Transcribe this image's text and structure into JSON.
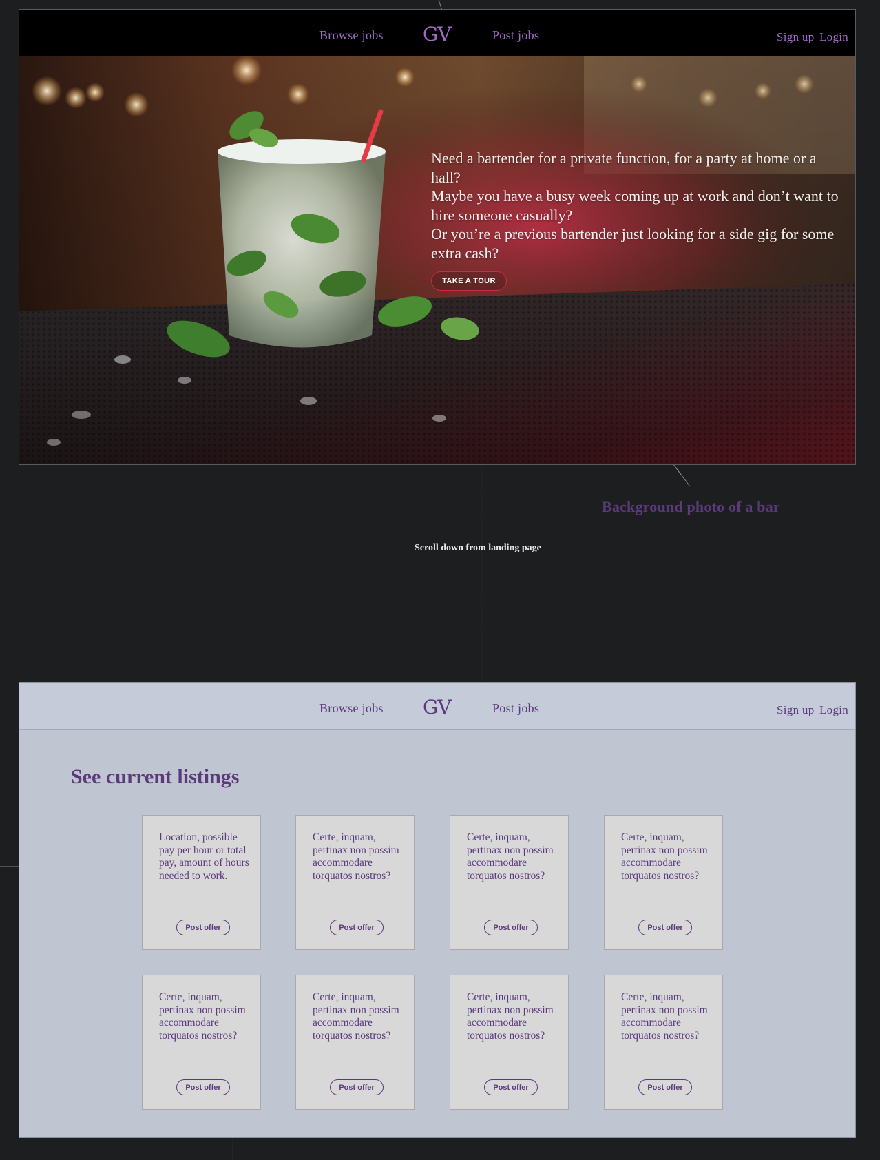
{
  "colors": {
    "accent_purple": "#5b3a7b",
    "nav_purple": "#a06bc7",
    "cta_red": "#d1274a",
    "canvas": "#1d1e20",
    "listings_bg": "#bfc5d1"
  },
  "landing": {
    "nav": {
      "browse": "Browse jobs",
      "logo": "GV",
      "post": "Post jobs",
      "signup": "Sign up",
      "login": "Login"
    },
    "hero": {
      "line1": "Need a bartender for a private function, for a party at home or a hall?",
      "line2": "Maybe you have a busy week coming up at work and don’t want to hire someone casually?",
      "line3": "Or you’re a previous bartender just looking for a side gig for some extra cash?",
      "cta": "TAKE A TOUR"
    }
  },
  "annotations": {
    "background_photo": "Background photo of a bar",
    "scroll_note": "Scroll down from landing page"
  },
  "listings_page": {
    "nav": {
      "browse": "Browse jobs",
      "logo": "GV",
      "post": "Post jobs",
      "signup": "Sign up",
      "login": "Login"
    },
    "title": "See current listings",
    "cards": [
      {
        "text": "Location, possible pay per hour or total pay, amount of hours needed to work.",
        "button": "Post offer"
      },
      {
        "text": "Certe, inquam, pertinax non possim accommodare torquatos nostros?",
        "button": "Post offer"
      },
      {
        "text": "Certe, inquam, pertinax non possim accommodare torquatos nostros?",
        "button": "Post offer"
      },
      {
        "text": "Certe, inquam, pertinax non possim accommodare torquatos nostros?",
        "button": "Post offer"
      },
      {
        "text": "Certe, inquam, pertinax non possim accommodare torquatos nostros?",
        "button": "Post offer"
      },
      {
        "text": "Certe, inquam, pertinax non possim accommodare torquatos nostros?",
        "button": "Post offer"
      },
      {
        "text": "Certe, inquam, pertinax non possim accommodare torquatos nostros?",
        "button": "Post offer"
      },
      {
        "text": "Certe, inquam, pertinax non possim accommodare torquatos nostros?",
        "button": "Post offer"
      }
    ]
  }
}
